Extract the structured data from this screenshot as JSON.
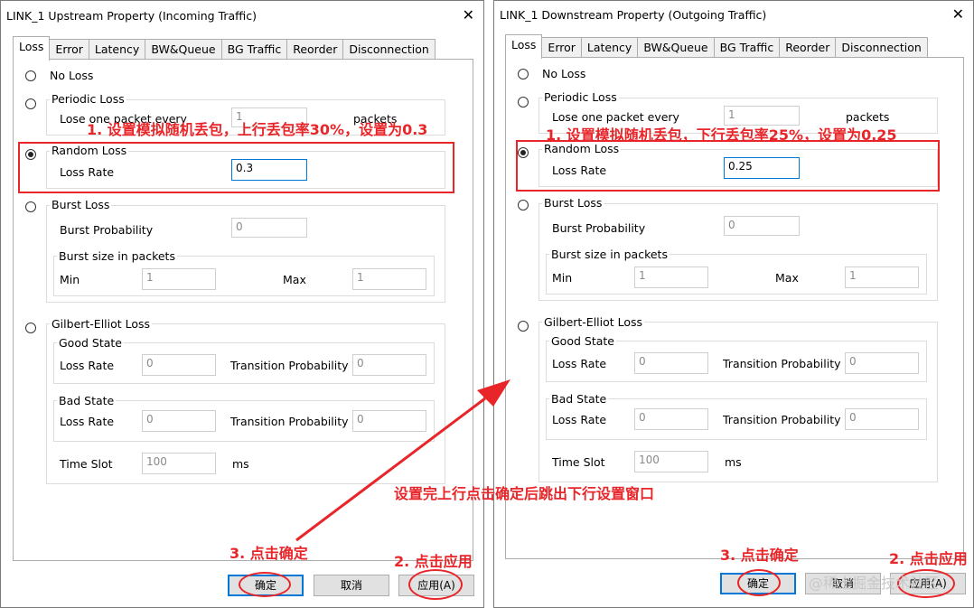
{
  "left": {
    "title": "LINK_1 Upstream Property (Incoming Traffic)",
    "tabs": [
      "Loss",
      "Error",
      "Latency",
      "BW&Queue",
      "BG  Traffic",
      "Reorder",
      "Disconnection"
    ],
    "no_loss": "No Loss",
    "periodic": {
      "title": "Periodic Loss",
      "label": "Lose one packet every",
      "value": "1",
      "unit": "packets"
    },
    "random": {
      "title": "Random Loss",
      "label": "Loss Rate",
      "value": "0.3"
    },
    "burst": {
      "title": "Burst Loss",
      "prob_label": "Burst Probability",
      "prob_value": "0",
      "size_title": "Burst size in packets",
      "min_label": "Min",
      "min_value": "1",
      "max_label": "Max",
      "max_value": "1"
    },
    "ge": {
      "title": "Gilbert-Elliot Loss",
      "good_title": "Good State",
      "good_loss_label": "Loss Rate",
      "good_loss_value": "0",
      "good_tp_label": "Transition Probability",
      "good_tp_value": "0",
      "bad_title": "Bad State",
      "bad_loss_label": "Loss Rate",
      "bad_loss_value": "0",
      "bad_tp_label": "Transition Probability",
      "bad_tp_value": "0",
      "timeslot_label": "Time Slot",
      "timeslot_value": "100",
      "timeslot_unit": "ms"
    },
    "ok": "确定",
    "cancel": "取消",
    "apply": "应用(A)"
  },
  "right": {
    "title": "LINK_1 Downstream Property (Outgoing Traffic)",
    "tabs": [
      "Loss",
      "Error",
      "Latency",
      "BW&Queue",
      "BG  Traffic",
      "Reorder",
      "Disconnection"
    ],
    "no_loss": "No Loss",
    "periodic": {
      "title": "Periodic Loss",
      "label": "Lose one packet every",
      "value": "1",
      "unit": "packets"
    },
    "random": {
      "title": "Random Loss",
      "label": "Loss Rate",
      "value": "0.25"
    },
    "burst": {
      "title": "Burst Loss",
      "prob_label": "Burst Probability",
      "prob_value": "0",
      "size_title": "Burst size in packets",
      "min_label": "Min",
      "min_value": "1",
      "max_label": "Max",
      "max_value": "1"
    },
    "ge": {
      "title": "Gilbert-Elliot Loss",
      "good_title": "Good State",
      "good_loss_label": "Loss Rate",
      "good_loss_value": "0",
      "good_tp_label": "Transition Probability",
      "good_tp_value": "0",
      "bad_title": "Bad State",
      "bad_loss_label": "Loss Rate",
      "bad_loss_value": "0",
      "bad_tp_label": "Transition Probability",
      "bad_tp_value": "0",
      "timeslot_label": "Time Slot",
      "timeslot_value": "100",
      "timeslot_unit": "ms"
    },
    "ok": "确定",
    "cancel": "取消",
    "apply": "应用(A)"
  },
  "annotations": {
    "left_step1": "1. 设置模拟随机丢包，上行丢包率30%，设置为0.3",
    "left_step2": "2. 点击应用",
    "left_step3": "3. 点击确定",
    "right_step1": "1. 设置模拟随机丢包，下行丢包率25%，设置为0.25",
    "right_step2": "2. 点击应用",
    "right_step3": "3. 点击确定",
    "middle_note": "设置完上行点击确定后跳出下行设置窗口"
  },
  "watermark": "@稀土掘金技术社区",
  "accent_red": "#e8262a",
  "accent_blue": "#0078d7"
}
